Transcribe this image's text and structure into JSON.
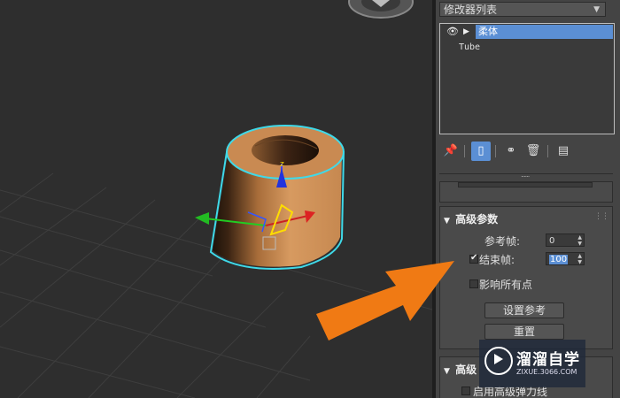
{
  "modifier_list": {
    "label": "修改器列表"
  },
  "stack": {
    "items": [
      {
        "label": "柔体",
        "selected": true
      },
      {
        "label": "Tube",
        "selected": false
      }
    ]
  },
  "toolbar": {
    "icons": [
      "pin-stack-icon",
      "show-end-result-icon",
      "make-unique-icon",
      "remove-modifier-icon",
      "configure-modifier-sets-icon"
    ]
  },
  "advanced_params": {
    "title": "高级参数",
    "ref_frame_label": "参考帧:",
    "ref_frame_value": "0",
    "end_frame_label": "结束帧:",
    "end_frame_value": "100",
    "end_frame_checked": true,
    "affect_all_label": "影响所有点",
    "affect_all_checked": false,
    "set_ref_button": "设置参考",
    "reset_button": "重置"
  },
  "advanced_springs": {
    "title": "高级",
    "enable_label": "启用高级弹力线",
    "enable_checked": false
  },
  "watermark": {
    "name": "溜溜自学",
    "url": "ZIXUE.3066.COM"
  },
  "colors": {
    "selection": "#5b8fd4",
    "object": "#c98a52",
    "selection_outline": "#3fd9e8",
    "arrow": "#f07a14"
  }
}
